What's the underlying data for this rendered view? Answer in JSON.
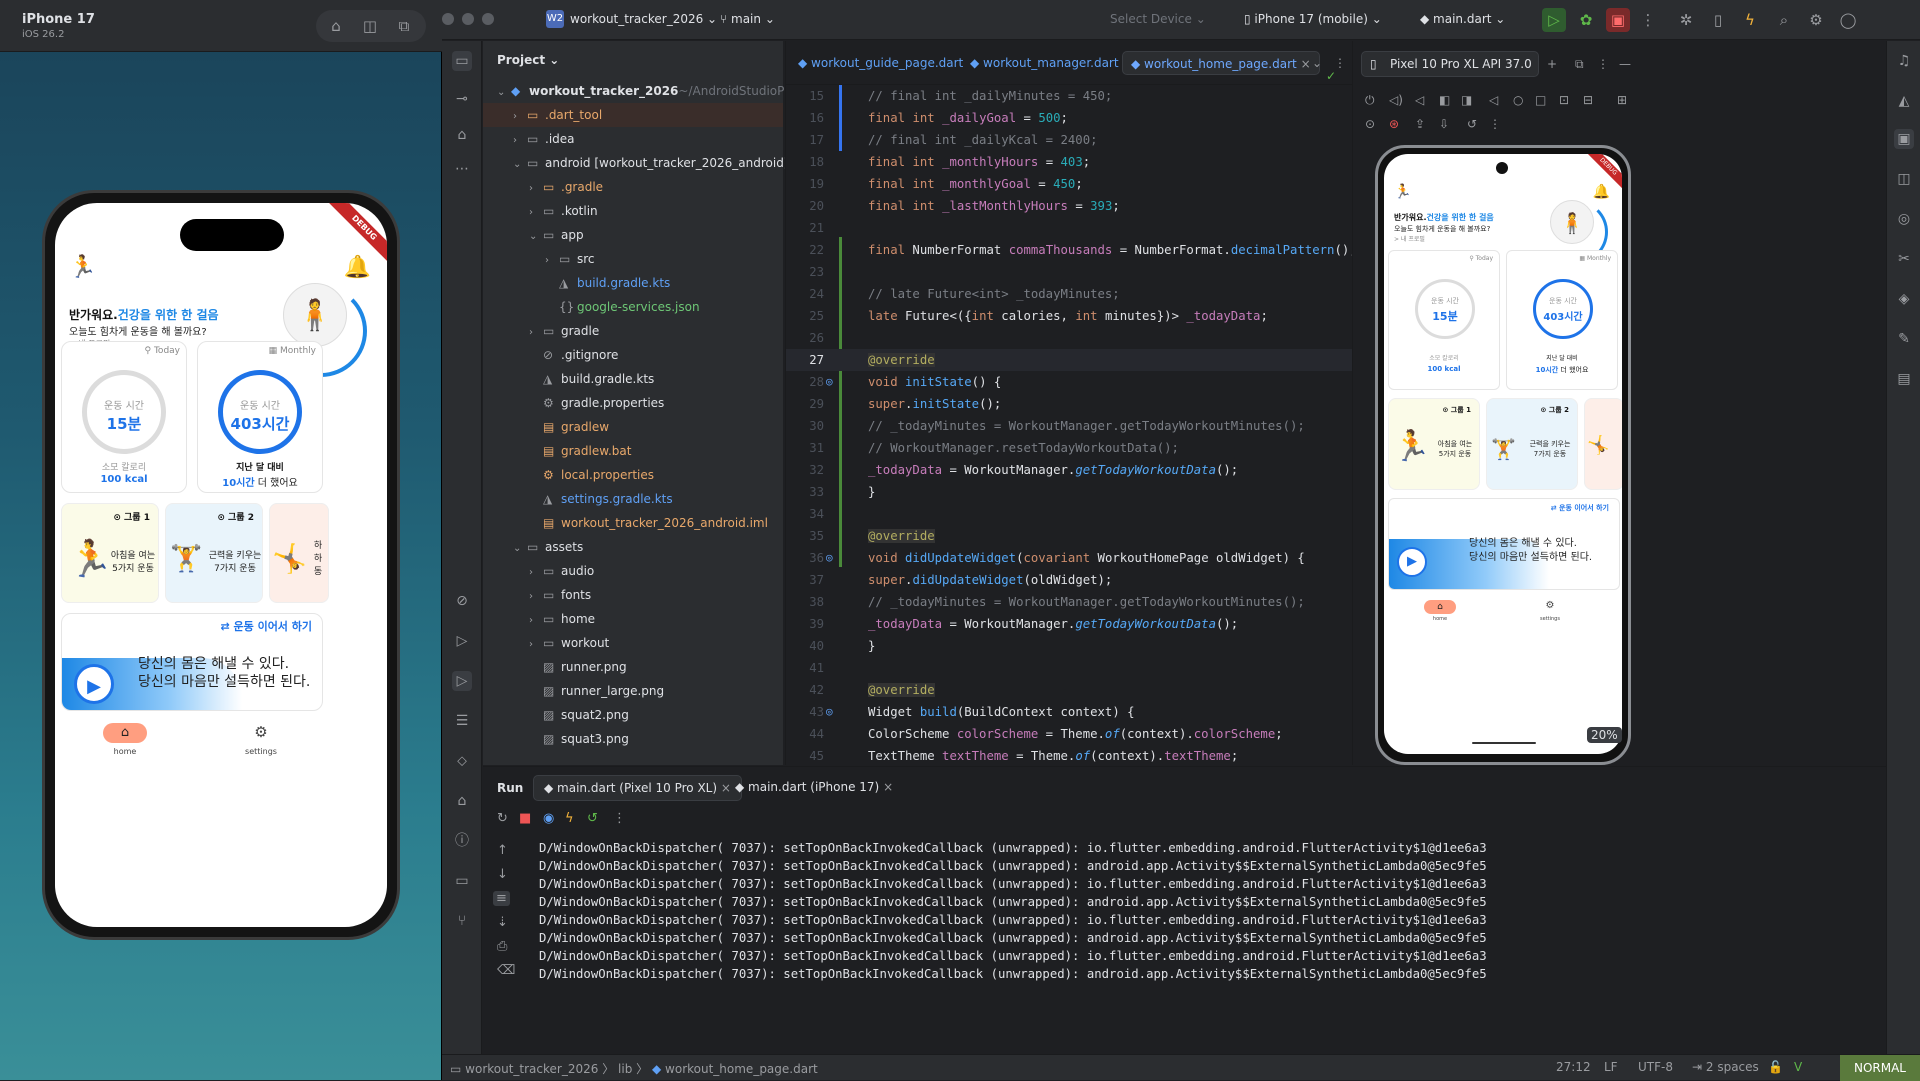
{
  "simulator": {
    "title": "iPhone 17",
    "subtitle": "iOS 26.2",
    "app": {
      "debug": "DEBUG",
      "greeting_prefix": "반가워요.",
      "greeting_highlight": "건강을 위한 한 걸음",
      "greeting_line2": "오늘도 힘차게 운동을 해 볼까요?",
      "profile_link": "> 내 프로필",
      "today_tag": "Today",
      "monthly_tag": "Monthly",
      "today_ring_label": "운동 시간",
      "today_ring_value": "15분",
      "today_kcal_label": "소모 칼로리",
      "today_kcal_value": "100 kcal",
      "monthly_ring_label": "운동 시간",
      "monthly_ring_value": "403시간",
      "monthly_compare_label": "지난 달 대비",
      "monthly_compare_value": "10시간",
      "monthly_compare_suffix": " 더 했어요",
      "group1_tag": "그룹 1",
      "group1_text": "아침을 여는\n5가지 운동",
      "group2_tag": "그룹 2",
      "group2_text": "근력을 키우는\n7가지 운동",
      "group3_text": "하\n하\n동",
      "continue": "운동 이어서 하기",
      "quote_line1": "당신의 몸은 해낼 수 있다.",
      "quote_line2": "당신의 마음만 설득하면 된다.",
      "tab_home": "home",
      "tab_settings": "settings"
    }
  },
  "ide": {
    "project_name": "workout_tracker_2026",
    "project_badge": "W2",
    "branch": "main",
    "select_device": "Select Device",
    "target_device": "iPhone 17 (mobile)",
    "run_config": "main.dart",
    "project_panel_title": "Project",
    "tree": [
      {
        "label": "workout_tracker_2026",
        "suffix": "~/AndroidStudioProje",
        "depth": 0,
        "arrow": "open",
        "icon": "module"
      },
      {
        "label": ".dart_tool",
        "depth": 1,
        "arrow": "closed",
        "icon": "folder",
        "color": "orange"
      },
      {
        "label": ".idea",
        "depth": 1,
        "arrow": "closed",
        "icon": "folder"
      },
      {
        "label": "android [workout_tracker_2026_android]",
        "depth": 1,
        "arrow": "open",
        "icon": "folder"
      },
      {
        "label": ".gradle",
        "depth": 2,
        "arrow": "closed",
        "icon": "folder",
        "color": "orange"
      },
      {
        "label": ".kotlin",
        "depth": 2,
        "arrow": "closed",
        "icon": "folder"
      },
      {
        "label": "app",
        "depth": 2,
        "arrow": "open",
        "icon": "folder"
      },
      {
        "label": "src",
        "depth": 3,
        "arrow": "closed",
        "icon": "folder"
      },
      {
        "label": "build.gradle.kts",
        "depth": 3,
        "arrow": "",
        "icon": "gradle",
        "color": "blue"
      },
      {
        "label": "google-services.json",
        "depth": 3,
        "arrow": "",
        "icon": "json",
        "color": "green"
      },
      {
        "label": "gradle",
        "depth": 2,
        "arrow": "closed",
        "icon": "folder"
      },
      {
        "label": ".gitignore",
        "depth": 2,
        "arrow": "",
        "icon": "ignore"
      },
      {
        "label": "build.gradle.kts",
        "depth": 2,
        "arrow": "",
        "icon": "gradle"
      },
      {
        "label": "gradle.properties",
        "depth": 2,
        "arrow": "",
        "icon": "gear"
      },
      {
        "label": "gradlew",
        "depth": 2,
        "arrow": "",
        "icon": "file",
        "color": "orange"
      },
      {
        "label": "gradlew.bat",
        "depth": 2,
        "arrow": "",
        "icon": "file",
        "color": "orange"
      },
      {
        "label": "local.properties",
        "depth": 2,
        "arrow": "",
        "icon": "gear",
        "color": "orange"
      },
      {
        "label": "settings.gradle.kts",
        "depth": 2,
        "arrow": "",
        "icon": "gradle",
        "color": "blue"
      },
      {
        "label": "workout_tracker_2026_android.iml",
        "depth": 2,
        "arrow": "",
        "icon": "file",
        "color": "orange"
      },
      {
        "label": "assets",
        "depth": 1,
        "arrow": "open",
        "icon": "folder"
      },
      {
        "label": "audio",
        "depth": 2,
        "arrow": "closed",
        "icon": "folder"
      },
      {
        "label": "fonts",
        "depth": 2,
        "arrow": "closed",
        "icon": "folder"
      },
      {
        "label": "home",
        "depth": 2,
        "arrow": "closed",
        "icon": "folder"
      },
      {
        "label": "workout",
        "depth": 2,
        "arrow": "closed",
        "icon": "folder"
      },
      {
        "label": "runner.png",
        "depth": 2,
        "arrow": "",
        "icon": "image"
      },
      {
        "label": "runner_large.png",
        "depth": 2,
        "arrow": "",
        "icon": "image"
      },
      {
        "label": "squat2.png",
        "depth": 2,
        "arrow": "",
        "icon": "image"
      },
      {
        "label": "squat3.png",
        "depth": 2,
        "arrow": "",
        "icon": "image"
      }
    ],
    "editor_tabs": [
      "workout_guide_page.dart",
      "workout_manager.dart",
      "workout_home_page.dart"
    ],
    "code_start_line": 15,
    "code": [
      "// final int _dailyMinutes = 450;",
      "final int _dailyGoal = 500;",
      "// final int _dailyKcal = 2400;",
      "final int _monthlyHours = 403;",
      "final int _monthlyGoal = 450;",
      "final int _lastMonthlyHours = 393;",
      "",
      "final NumberFormat commaThousands = NumberFormat.decimalPattern();",
      "",
      "// late Future<int> _todayMinutes;",
      "late Future<({int calories, int minutes})> _todayData;",
      "",
      "@override",
      "void initState() {",
      "  super.initState();",
      "  // _todayMinutes = WorkoutManager.getTodayWorkoutMinutes();",
      "  // WorkoutManager.resetTodayWorkoutData();",
      "  _todayData = WorkoutManager.getTodayWorkoutData();",
      "}",
      "",
      "@override",
      "void didUpdateWidget(covariant WorkoutHomePage oldWidget) {",
      "  super.didUpdateWidget(oldWidget);",
      "  // _todayMinutes = WorkoutManager.getTodayWorkoutMinutes();",
      "  _todayData = WorkoutManager.getTodayWorkoutData();",
      "}",
      "",
      "@override",
      "Widget build(BuildContext context) {",
      "  ColorScheme colorScheme = Theme.of(context).colorScheme;",
      "  TextTheme textTheme = Theme.of(context).textTheme;"
    ],
    "current_line": 27,
    "emulator_tab": "Pixel 10 Pro XL API 37.0",
    "emulator_zoom": "20%",
    "run_title": "Run",
    "run_tabs": [
      "main.dart (Pixel 10 Pro XL)",
      "main.dart (iPhone 17)"
    ],
    "log": [
      "D/WindowOnBackDispatcher( 7037): setTopOnBackInvokedCallback (unwrapped): io.flutter.embedding.android.FlutterActivity$1@d1ee6a3",
      "D/WindowOnBackDispatcher( 7037): setTopOnBackInvokedCallback (unwrapped): android.app.Activity$$ExternalSyntheticLambda0@5ec9fe5",
      "D/WindowOnBackDispatcher( 7037): setTopOnBackInvokedCallback (unwrapped): io.flutter.embedding.android.FlutterActivity$1@d1ee6a3",
      "D/WindowOnBackDispatcher( 7037): setTopOnBackInvokedCallback (unwrapped): android.app.Activity$$ExternalSyntheticLambda0@5ec9fe5",
      "D/WindowOnBackDispatcher( 7037): setTopOnBackInvokedCallback (unwrapped): io.flutter.embedding.android.FlutterActivity$1@d1ee6a3",
      "D/WindowOnBackDispatcher( 7037): setTopOnBackInvokedCallback (unwrapped): android.app.Activity$$ExternalSyntheticLambda0@5ec9fe5",
      "D/WindowOnBackDispatcher( 7037): setTopOnBackInvokedCallback (unwrapped): io.flutter.embedding.android.FlutterActivity$1@d1ee6a3",
      "D/WindowOnBackDispatcher( 7037): setTopOnBackInvokedCallback (unwrapped): android.app.Activity$$ExternalSyntheticLambda0@5ec9fe5"
    ],
    "status": {
      "crumb1": "workout_tracker_2026",
      "crumb2": "lib",
      "crumb3": "workout_home_page.dart",
      "position": "27:12",
      "line_sep": "LF",
      "encoding": "UTF-8",
      "indent": "2 spaces",
      "mode": "NORMAL"
    }
  }
}
